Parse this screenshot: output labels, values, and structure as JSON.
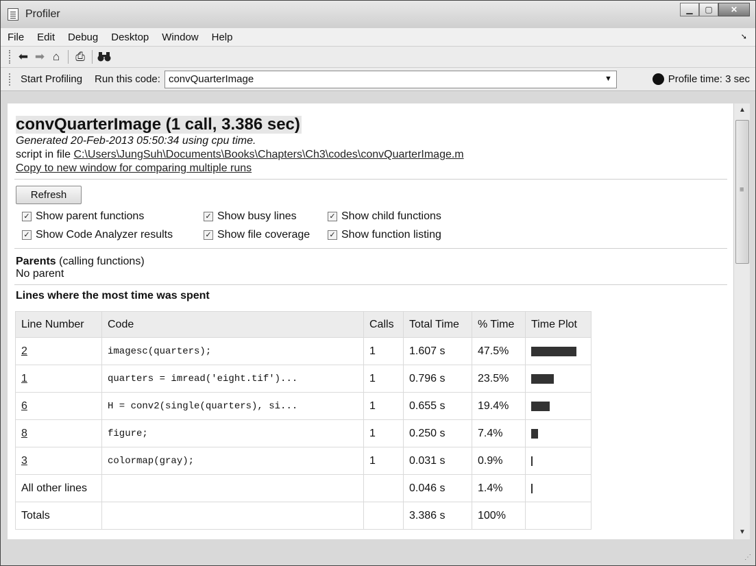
{
  "window": {
    "title": "Profiler"
  },
  "menu": [
    "File",
    "Edit",
    "Debug",
    "Desktop",
    "Window",
    "Help"
  ],
  "toolbar": {
    "icons": [
      "back-arrow-icon",
      "forward-arrow-icon",
      "home-icon",
      "print-icon",
      "find-binoculars-icon"
    ]
  },
  "runbar": {
    "start_label": "Start Profiling",
    "run_label": "Run this code:",
    "run_value": "convQuarterImage",
    "profile_time": "Profile time: 3 sec"
  },
  "report": {
    "title": "convQuarterImage (1 call, 3.386 sec)",
    "generated": "Generated 20-Feb-2013 05:50:34 using cpu time.",
    "script_prefix": "script in file",
    "script_path": "C:\\Users\\JungSuh\\Documents\\Books\\Chapters\\Ch3\\codes\\convQuarterImage.m",
    "copy_link": "Copy to new window for comparing multiple runs",
    "refresh": "Refresh",
    "options": [
      {
        "label": "Show parent functions",
        "checked": true
      },
      {
        "label": "Show busy lines",
        "checked": true
      },
      {
        "label": "Show child functions",
        "checked": true
      },
      {
        "label": "Show Code Analyzer results",
        "checked": true
      },
      {
        "label": "Show file coverage",
        "checked": true
      },
      {
        "label": "Show function listing",
        "checked": true
      }
    ],
    "parents_bold": "Parents",
    "parents_rest": "(calling functions)",
    "parents_value": "No parent",
    "lines_heading": "Lines where the most time was spent"
  },
  "table": {
    "headers": [
      "Line Number",
      "Code",
      "Calls",
      "Total Time",
      "% Time",
      "Time Plot"
    ],
    "rows": [
      {
        "line": "2",
        "code": "imagesc(quarters);",
        "calls": "1",
        "total": "1.607 s",
        "pct": "47.5%",
        "plot": 0.475
      },
      {
        "line": "1",
        "code": "quarters = imread('eight.tif')...",
        "calls": "1",
        "total": "0.796 s",
        "pct": "23.5%",
        "plot": 0.235
      },
      {
        "line": "6",
        "code": "H = conv2(single(quarters), si...",
        "calls": "1",
        "total": "0.655 s",
        "pct": "19.4%",
        "plot": 0.194
      },
      {
        "line": "8",
        "code": "figure;",
        "calls": "1",
        "total": "0.250 s",
        "pct": "7.4%",
        "plot": 0.074
      },
      {
        "line": "3",
        "code": "colormap(gray);",
        "calls": "1",
        "total": "0.031 s",
        "pct": "0.9%",
        "plot": 0.009
      },
      {
        "line": "All other lines",
        "code": "",
        "calls": "",
        "total": "0.046 s",
        "pct": "1.4%",
        "plot": 0.014
      },
      {
        "line": "Totals",
        "code": "",
        "calls": "",
        "total": "3.386 s",
        "pct": "100%",
        "plot": null
      }
    ]
  }
}
